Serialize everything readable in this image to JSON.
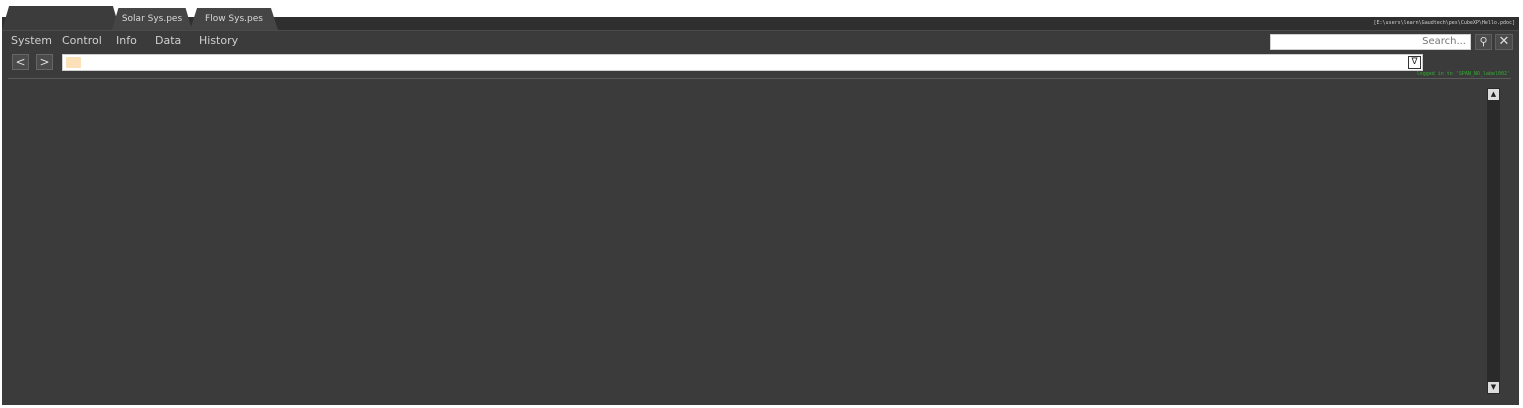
{
  "tabs": [
    {
      "label": ""
    },
    {
      "label": "Solar Sys.pes"
    },
    {
      "label": "Flow Sys.pes"
    }
  ],
  "path_label": "[E:\\users\\learn\\Gaudtech\\pes\\CubeXP\\Hello.pdoc]",
  "menu": {
    "items": [
      "System",
      "Control",
      "Info",
      "Data",
      "History"
    ]
  },
  "search": {
    "placeholder": "Search...",
    "button_icon": "search-icon",
    "close_icon": "close-icon"
  },
  "nav": {
    "back": "<",
    "forward": ">"
  },
  "address": {
    "folder_icon": "folder-icon",
    "dropdown_icon": "dropdown-triangle-icon",
    "dropdown_glyph": "∇"
  },
  "status_text": "logged in to 'SPAN_NO_label002'",
  "scrollbar": {
    "up_glyph": "▲",
    "down_glyph": "▼"
  },
  "colors": {
    "background": "#3b3b3b",
    "tab": "#454545",
    "status": "#2fae2f"
  }
}
